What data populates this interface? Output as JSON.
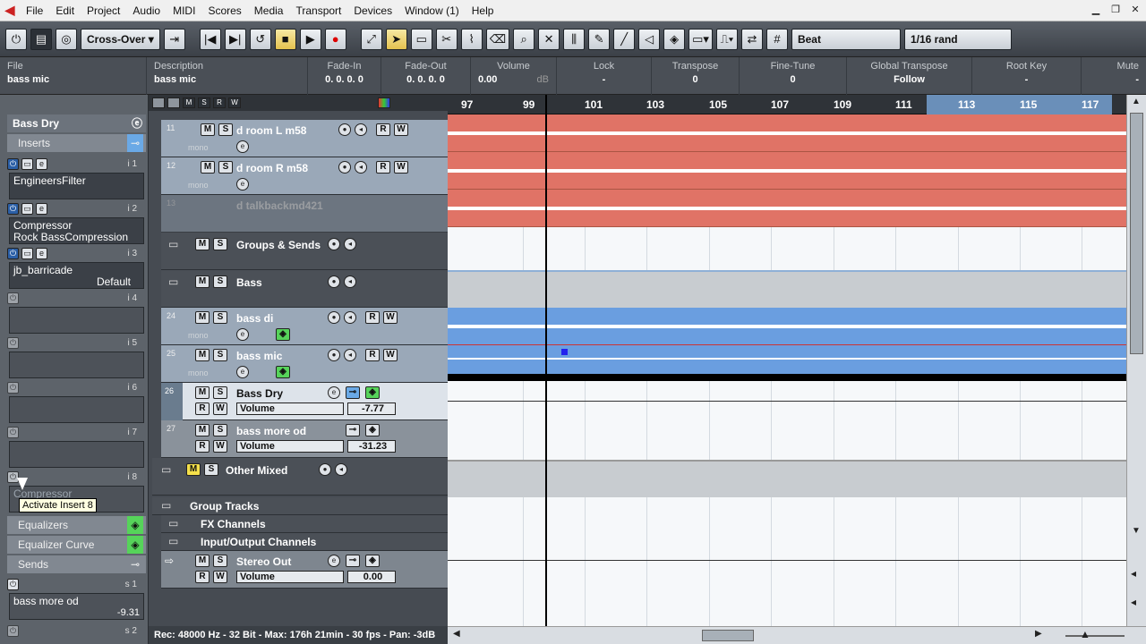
{
  "menubar": {
    "items": [
      "File",
      "Edit",
      "Project",
      "Audio",
      "MIDI",
      "Scores",
      "Media",
      "Transport",
      "Devices",
      "Window (1)",
      "Help"
    ]
  },
  "toolbar": {
    "mode": "Cross-Over",
    "snap_type": "Beat",
    "quantize": "1/16 rand"
  },
  "infoline": {
    "columns": [
      {
        "header": "File",
        "value": "bass mic"
      },
      {
        "header": "Description",
        "value": "bass mic"
      },
      {
        "header": "Fade-In",
        "value": "0. 0. 0.  0"
      },
      {
        "header": "Fade-Out",
        "value": "0. 0. 0.  0"
      },
      {
        "header": "Volume",
        "value": "0.00"
      },
      {
        "header": "Lock",
        "value": "-"
      },
      {
        "header": "Transpose",
        "value": "0"
      },
      {
        "header": "Fine-Tune",
        "value": "0"
      },
      {
        "header": "Global Transpose",
        "value": "Follow"
      },
      {
        "header": "Root Key",
        "value": "-"
      },
      {
        "header": "Mute",
        "value": "-"
      }
    ],
    "volume_unit": "dB"
  },
  "inspector": {
    "track_name": "Bass Dry",
    "inserts_label": "Inserts",
    "slots": [
      {
        "num": "i 1",
        "line1": "EngineersFilter",
        "line2": ""
      },
      {
        "num": "i 2",
        "line1": "Compressor",
        "line2": "Rock BassCompression"
      },
      {
        "num": "i 3",
        "line1": "jb_barricade",
        "line2": "Default"
      },
      {
        "num": "i 4",
        "line1": "",
        "line2": ""
      },
      {
        "num": "i 5",
        "line1": "",
        "line2": ""
      },
      {
        "num": "i 6",
        "line1": "",
        "line2": ""
      },
      {
        "num": "i 7",
        "line1": "",
        "line2": ""
      },
      {
        "num": "i 8",
        "line1": "Compressor",
        "line2": ""
      }
    ],
    "tooltip": "Activate Insert 8",
    "equalizers_label": "Equalizers",
    "eq_curve_label": "Equalizer Curve",
    "sends_label": "Sends",
    "send1": {
      "num": "s 1",
      "name": "bass more od",
      "value": "-9.31"
    },
    "send2_num": "s 2"
  },
  "tracks": {
    "t11": {
      "num": "11",
      "name": "d room L m58",
      "mono": "mono"
    },
    "t12": {
      "num": "12",
      "name": "d room R m58",
      "mono": "mono"
    },
    "t13": {
      "num": "13",
      "name": "d talkbackmd421"
    },
    "groups": {
      "name": "Groups & Sends"
    },
    "bass": {
      "name": "Bass"
    },
    "t24": {
      "num": "24",
      "name": "bass di",
      "mono": "mono"
    },
    "t25": {
      "num": "25",
      "name": "bass mic",
      "mono": "mono"
    },
    "t26": {
      "num": "26",
      "name": "Bass Dry",
      "param": "Volume",
      "value": "-7.77"
    },
    "t27": {
      "num": "27",
      "name": "bass more od",
      "param": "Volume",
      "value": "-31.23"
    },
    "other": {
      "name": "Other Mixed"
    },
    "group_tracks": {
      "name": "Group Tracks"
    },
    "fx": {
      "name": "FX Channels"
    },
    "io": {
      "name": "Input/Output Channels"
    },
    "stereo_out": {
      "name": "Stereo Out",
      "param": "Volume",
      "value": "0.00"
    }
  },
  "ruler": {
    "bars": [
      "97",
      "99",
      "101",
      "103",
      "105",
      "107",
      "109",
      "111",
      "113",
      "115",
      "117"
    ]
  },
  "status": "Rec: 48000 Hz - 32 Bit - Max: 176h 21min - 30 fps - Pan: -3dB"
}
